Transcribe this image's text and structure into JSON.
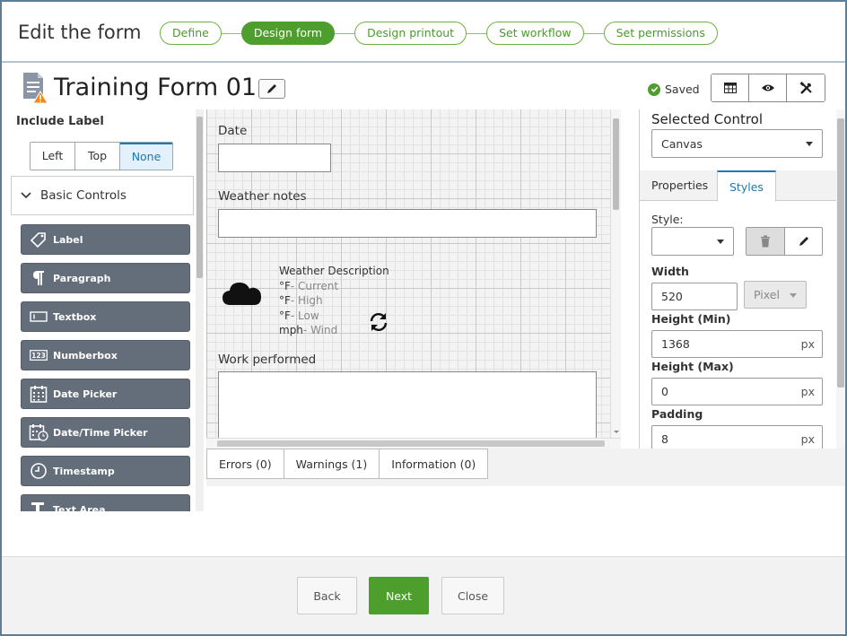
{
  "header": {
    "title": "Edit the form",
    "steps": [
      "Define",
      "Design form",
      "Design printout",
      "Set workflow",
      "Set permissions"
    ],
    "active_step": "Design form"
  },
  "titlebar": {
    "form_title": "Training Form 01",
    "status": "Saved"
  },
  "left_panel": {
    "include_label_title": "Include Label",
    "label_options": [
      "Left",
      "Top",
      "None"
    ],
    "selected_label_option": "None",
    "section_title": "Basic Controls",
    "controls": [
      "Label",
      "Paragraph",
      "Textbox",
      "Numberbox",
      "Date Picker",
      "Date/Time Picker",
      "Timestamp",
      "Text Area"
    ]
  },
  "canvas": {
    "field_date_label": "Date",
    "field_weather_label": "Weather notes",
    "weather_title": "Weather Description",
    "weather_lines": [
      {
        "unit": "°F",
        "text": "- Current"
      },
      {
        "unit": "°F",
        "text": "- High"
      },
      {
        "unit": "°F",
        "text": "- Low"
      },
      {
        "unit": "mph",
        "text": "- Wind"
      }
    ],
    "field_work_label": "Work performed"
  },
  "bottom_tabs": [
    "Errors (0)",
    "Warnings (1)",
    "Information (0)"
  ],
  "right_panel": {
    "title": "Selected Control",
    "selected_control": "Canvas",
    "tabs": [
      "Properties",
      "Styles"
    ],
    "active_tab": "Styles",
    "style_label": "Style:",
    "style_value": "",
    "width_label": "Width",
    "width_value": "520",
    "width_unit": "Pixel",
    "height_min_label": "Height (Min)",
    "height_min_value": "1368",
    "height_max_label": "Height (Max)",
    "height_max_value": "0",
    "padding_label": "Padding",
    "padding_value": "8",
    "px_unit": "px"
  },
  "footer": {
    "back": "Back",
    "next": "Next",
    "close": "Close"
  },
  "colors": {
    "accent_green": "#4d9e2c",
    "control_gray": "#646d7a",
    "link_blue": "#1f77b4",
    "warning_orange": "#f08a1c"
  }
}
